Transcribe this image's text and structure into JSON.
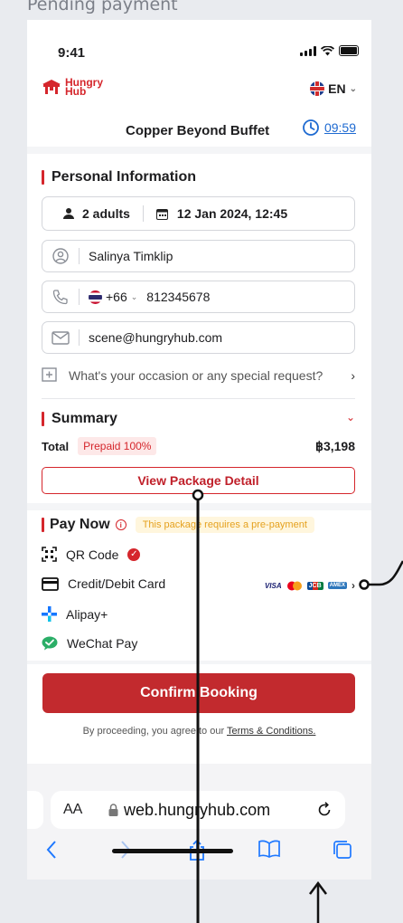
{
  "frame_title": "Pending payment",
  "status_bar": {
    "time": "9:41"
  },
  "header": {
    "logo_line1": "Hungry",
    "logo_line2": "Hub",
    "language": "EN"
  },
  "restaurant": {
    "name": "Copper Beyond Buffet",
    "timer": "09:59"
  },
  "personal": {
    "title": "Personal Information",
    "guests": "2 adults",
    "datetime": "12 Jan 2024, 12:45",
    "name": "Salinya Timklip",
    "country_code": "+66",
    "phone": "812345678",
    "email": "scene@hungryhub.com",
    "special_request": "What's your occasion or any special request?"
  },
  "summary": {
    "title": "Summary",
    "total_label": "Total",
    "prepaid_badge": "Prepaid 100%",
    "total_amount": "฿3,198",
    "view_package": "View Package Detail"
  },
  "pay": {
    "title": "Pay Now",
    "note": "This package requires a pre-payment",
    "methods": [
      "QR Code",
      "Credit/Debit Card",
      "Alipay+",
      "WeChat Pay"
    ],
    "card_brands": [
      "VISA",
      "MC",
      "JCB",
      "AMEX"
    ]
  },
  "confirm": {
    "button": "Confirm Booking",
    "terms_prefix": "By proceeding, you agree to our",
    "terms_link": "Terms & Conditions."
  },
  "browser": {
    "aa": "AA",
    "url": "web.hungryhub.com"
  },
  "colors": {
    "brand_red": "#d5262c",
    "link_blue": "#1e6ad1",
    "ios_blue": "#1e78ff"
  }
}
